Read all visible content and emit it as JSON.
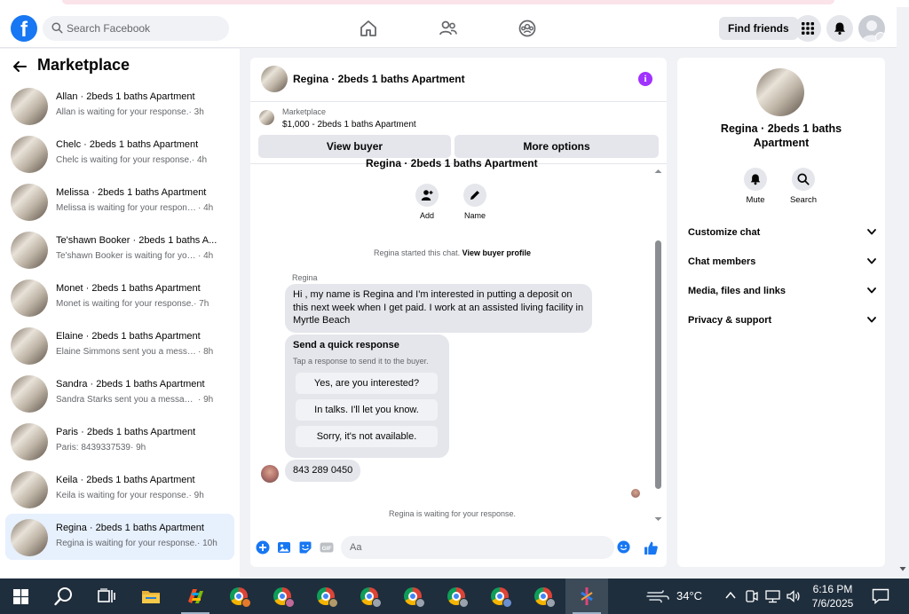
{
  "topnav": {
    "logo": "f",
    "search_placeholder": "Search Facebook",
    "find_friends_label": "Find friends"
  },
  "marketplace": {
    "title": "Marketplace",
    "conversations": [
      {
        "title": "Allan · 2beds 1 baths Apartment",
        "preview": "Allan is waiting for your response.",
        "time": "· 3h",
        "active": false
      },
      {
        "title": "Chelc · 2beds 1 baths Apartment",
        "preview": "Chelc is waiting for your response.",
        "time": "· 4h",
        "active": false
      },
      {
        "title": "Melissa · 2beds 1 baths Apartment",
        "preview": "Melissa is waiting for your response.",
        "time": "· 4h",
        "active": false
      },
      {
        "title": "Te'shawn Booker · 2beds 1 baths A...",
        "preview": "Te'shawn Booker is waiting for your re...",
        "time": "· 4h",
        "active": false
      },
      {
        "title": "Monet · 2beds 1 baths Apartment",
        "preview": "Monet is waiting for your response.",
        "time": "· 7h",
        "active": false
      },
      {
        "title": "Elaine · 2beds 1 baths Apartment",
        "preview": "Elaine Simmons sent you a message a...",
        "time": "· 8h",
        "active": false
      },
      {
        "title": "Sandra · 2beds 1 baths Apartment",
        "preview": "Sandra Starks sent you a message ab...",
        "time": "· 9h",
        "active": false
      },
      {
        "title": "Paris · 2beds 1 baths Apartment",
        "preview": "Paris: 8439337539",
        "time": "· 9h",
        "active": false
      },
      {
        "title": "Keila · 2beds 1 baths Apartment",
        "preview": "Keila is waiting for your response.",
        "time": "· 9h",
        "active": false
      },
      {
        "title": "Regina · 2beds 1 baths Apartment",
        "preview": "Regina is waiting for your response.",
        "time": "· 10h",
        "active": true
      }
    ]
  },
  "chat": {
    "header_title": "Regina · 2beds 1 baths Apartment",
    "listing_source": "Marketplace",
    "listing_price_title": "$1,000 - 2beds 1 baths Apartment",
    "view_buyer_label": "View buyer",
    "more_options_label": "More options",
    "clipped_title": "Regina · 2beds 1 baths Apartment",
    "add_label": "Add",
    "name_label": "Name",
    "started_text": "Regina started this chat.",
    "view_buyer_profile": "View buyer profile",
    "sender_name": "Regina",
    "message_1": "Hi , my name is Regina and I'm interested in putting a deposit on this next week when I get paid.  I work at an assisted living facility in Myrtle Beach",
    "quick_title": "Send a quick response",
    "quick_subtitle": "Tap a response to send it to the buyer.",
    "quick_replies": [
      "Yes, are you interested?",
      "In talks. I'll let you know.",
      "Sorry, it's not available."
    ],
    "message_2": "843 289 0450",
    "waiting_text": "Regina is waiting for your response.",
    "composer_placeholder": "Aa"
  },
  "details": {
    "name": "Regina · 2beds 1 baths Apartment",
    "mute_label": "Mute",
    "search_label": "Search",
    "sections": [
      "Customize chat",
      "Chat members",
      "Media, files and links",
      "Privacy & support"
    ]
  },
  "taskbar": {
    "temperature": "34°C",
    "time": "6:16 PM",
    "date": "7/6/2025"
  },
  "colors": {
    "facebook_blue": "#1877f2",
    "active_conversation_bg": "#e7f0fd",
    "info_purple": "#a033ff",
    "taskbar_bg": "#1f2e3d"
  }
}
